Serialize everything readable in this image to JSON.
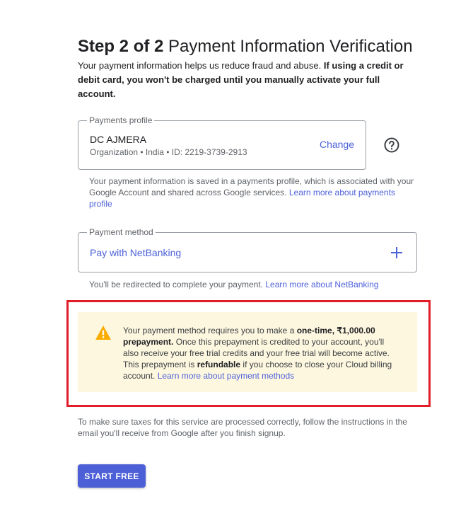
{
  "header": {
    "step_label": "Step 2 of 2",
    "title": "Payment Information Verification",
    "intro_text": "Your payment information helps us reduce fraud and abuse.",
    "intro_bold": "If using a credit or debit card, you won't be charged until you manually activate your full account."
  },
  "payments_profile": {
    "legend": "Payments profile",
    "name": "DC AJMERA",
    "meta": "Organization • India • ID: 2219-3739-2913",
    "change_label": "Change",
    "help_icon": "help-circle-icon",
    "description": "Your payment information is saved in a payments profile, which is associated with your Google Account and shared across Google services.",
    "learn_more": "Learn more about payments profile"
  },
  "payment_method": {
    "legend": "Payment method",
    "label": "Pay with NetBanking",
    "add_icon": "plus-icon",
    "description": "You'll be redirected to complete your payment.",
    "learn_more": "Learn more about NetBanking"
  },
  "notice": {
    "icon": "warning-icon",
    "text_1": "Your payment method requires you to make a ",
    "bold_1": "one-time, ₹1,000.00 prepayment.",
    "text_2": " Once this prepayment is credited to your account, you'll also receive your free trial credits and your free trial will become active. This prepayment is ",
    "bold_2": "refundable",
    "text_3": " if you choose to close your Cloud billing account. ",
    "learn_more": "Learn more about payment methods",
    "highlight_color": "#e11d2a",
    "background_color": "#fef7e0"
  },
  "taxes_note": "To make sure taxes for this service are processed correctly, follow the instructions in the email you'll receive from Google after you finish signup.",
  "start_button": "START FREE",
  "colors": {
    "accent": "#4d61d9",
    "button": "#4d5fd6"
  }
}
